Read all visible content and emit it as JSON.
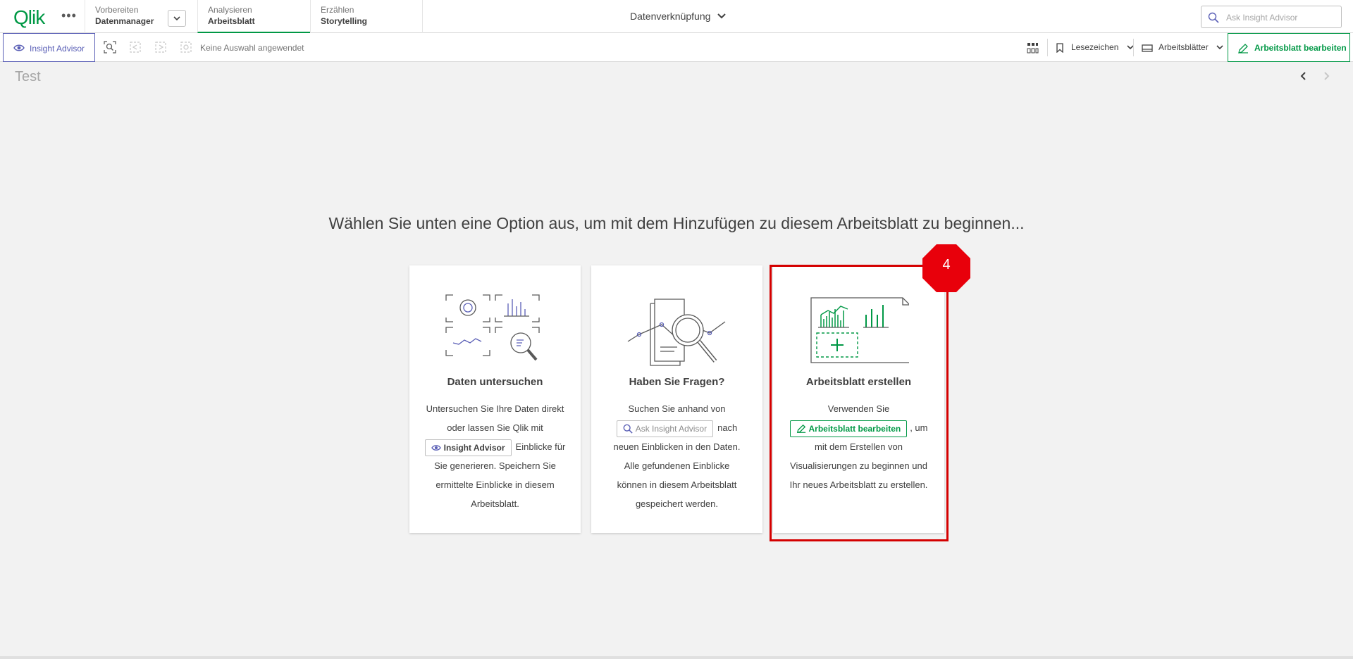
{
  "topbar": {
    "logo": "Qlik",
    "stages": [
      {
        "label": "Vorbereiten",
        "value": "Datenmanager"
      },
      {
        "label": "Analysieren",
        "value": "Arbeitsblatt"
      },
      {
        "label": "Erzählen",
        "value": "Storytelling"
      }
    ],
    "app_title": "Datenverknüpfung",
    "search_placeholder": "Ask Insight Advisor"
  },
  "toolbar": {
    "insight_advisor": "Insight Advisor",
    "no_selection": "Keine Auswahl angewendet",
    "bookmarks": "Lesezeichen",
    "sheets": "Arbeitsblätter",
    "edit_sheet": "Arbeitsblatt bearbeiten"
  },
  "sheet": {
    "title": "Test",
    "headline": "Wählen Sie unten eine Option aus, um mit dem Hinzufügen zu diesem Arbeitsblatt zu beginnen..."
  },
  "cards": [
    {
      "title": "Daten untersuchen",
      "text_before": "Untersuchen Sie Ihre Daten direkt oder lassen Sie Qlik mit",
      "button": "Insight Advisor",
      "text_after": "Einblicke für Sie generieren. Speichern Sie ermittelte Einblicke in diesem Arbeitsblatt."
    },
    {
      "title": "Haben Sie Fragen?",
      "text_before": "Suchen Sie anhand von",
      "button": "Ask Insight Advisor",
      "text_after": "nach neuen Einblicken in den Daten. Alle gefundenen Einblicke können in diesem Arbeitsblatt gespeichert werden."
    },
    {
      "title": "Arbeitsblatt erstellen",
      "text_before": "Verwenden Sie",
      "button": "Arbeitsblatt bearbeiten",
      "text_after": ", um mit dem Erstellen von Visualisierungen zu beginnen und Ihr neues Arbeitsblatt zu erstellen."
    }
  ],
  "annotation": {
    "step": "4"
  },
  "colors": {
    "brand_green": "#009845",
    "insight_purple": "#5a5fb6",
    "highlight_red": "#d40000"
  }
}
